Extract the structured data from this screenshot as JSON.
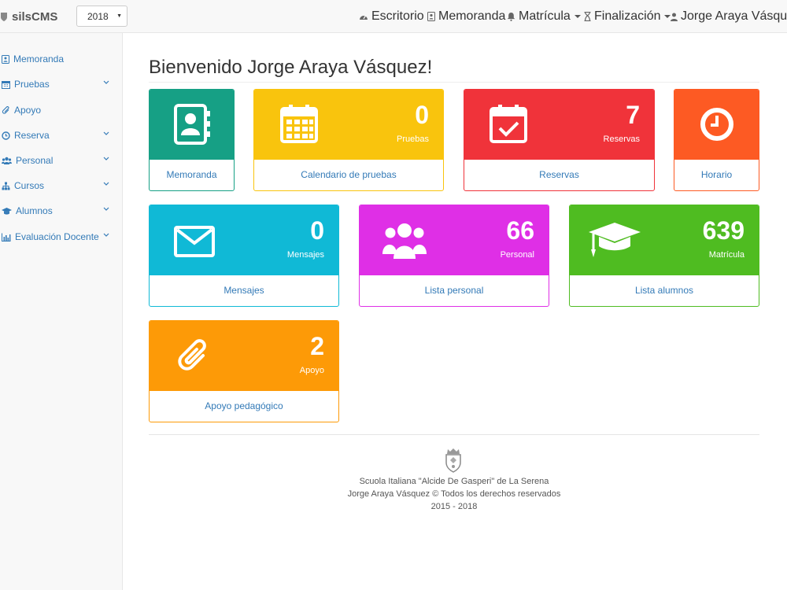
{
  "navbar": {
    "brand": "silsCMS",
    "year": "2018",
    "escritorio": "Escritorio",
    "memoranda": "Memoranda",
    "matricula": "Matrícula",
    "finalizacion": "Finalización",
    "user": "Jorge Araya Vásquez"
  },
  "sidebar": {
    "items": [
      {
        "label": "Memoranda",
        "icon": "memo-icon",
        "has_submenu": false
      },
      {
        "label": "Pruebas",
        "icon": "calendar-icon",
        "has_submenu": true
      },
      {
        "label": "Apoyo",
        "icon": "paperclip-icon",
        "has_submenu": false
      },
      {
        "label": "Reserva",
        "icon": "clock-icon",
        "has_submenu": true
      },
      {
        "label": "Personal",
        "icon": "users-icon",
        "has_submenu": true
      },
      {
        "label": "Cursos",
        "icon": "sitemap-icon",
        "has_submenu": true
      },
      {
        "label": "Alumnos",
        "icon": "graduation-cap-icon",
        "has_submenu": true
      },
      {
        "label": "Evaluación Docente",
        "icon": "bar-chart-icon",
        "has_submenu": true
      }
    ]
  },
  "main": {
    "title": "Bienvenido Jorge Araya Vásquez!",
    "panels": [
      {
        "footer": "Memoranda",
        "count": "",
        "caption": "",
        "icon": "contact-book-icon",
        "color": "#16a085"
      },
      {
        "footer": "Calendario de pruebas",
        "count": "0",
        "caption": "Pruebas",
        "icon": "calendar-icon",
        "color": "#f9c40d"
      },
      {
        "footer": "Reservas",
        "count": "7",
        "caption": "Reservas",
        "icon": "calendar-check-icon",
        "color": "#f0333a"
      },
      {
        "footer": "Horario",
        "count": "",
        "caption": "",
        "icon": "clock-icon",
        "color": "#fd5a23"
      },
      {
        "footer": "Mensajes",
        "count": "0",
        "caption": "Mensajes",
        "icon": "envelope-icon",
        "color": "#10b9d6"
      },
      {
        "footer": "Lista personal",
        "count": "66",
        "caption": "Personal",
        "icon": "users-icon",
        "color": "#df2fe6"
      },
      {
        "footer": "Lista alumnos",
        "count": "639",
        "caption": "Matrícula",
        "icon": "graduation-cap-icon",
        "color": "#4fbc21"
      },
      {
        "footer": "Apoyo pedagógico",
        "count": "2",
        "caption": "Apoyo",
        "icon": "paperclip-icon",
        "color": "#fd9a07"
      }
    ]
  },
  "footer": {
    "school": "Scuola Italiana \"Alcide De Gasperi\" de La Serena",
    "copyright": "Jorge Araya Vásquez © Todos los derechos reservados",
    "years": "2015 - 2018"
  }
}
